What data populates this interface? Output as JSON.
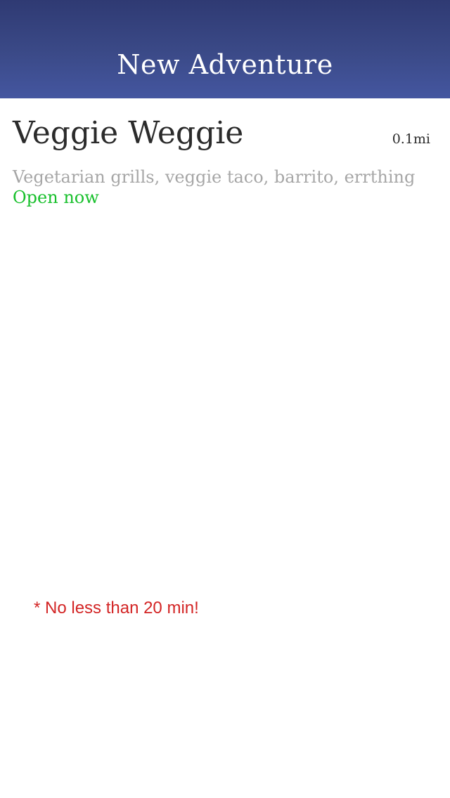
{
  "nav": {
    "title": "New Adventure"
  },
  "restaurant": {
    "name": "Veggie Weggie",
    "distance": "0.1mi",
    "description": "Vegetarian grills, veggie taco, barrito, errthing",
    "status": "Open now"
  },
  "note": {
    "text": "* No less than 20 min!"
  },
  "colors": {
    "nav_background": "#3b4a88",
    "status_open": "#18c02c",
    "note_warning": "#d32525",
    "description_gray": "#a6a6a6"
  }
}
